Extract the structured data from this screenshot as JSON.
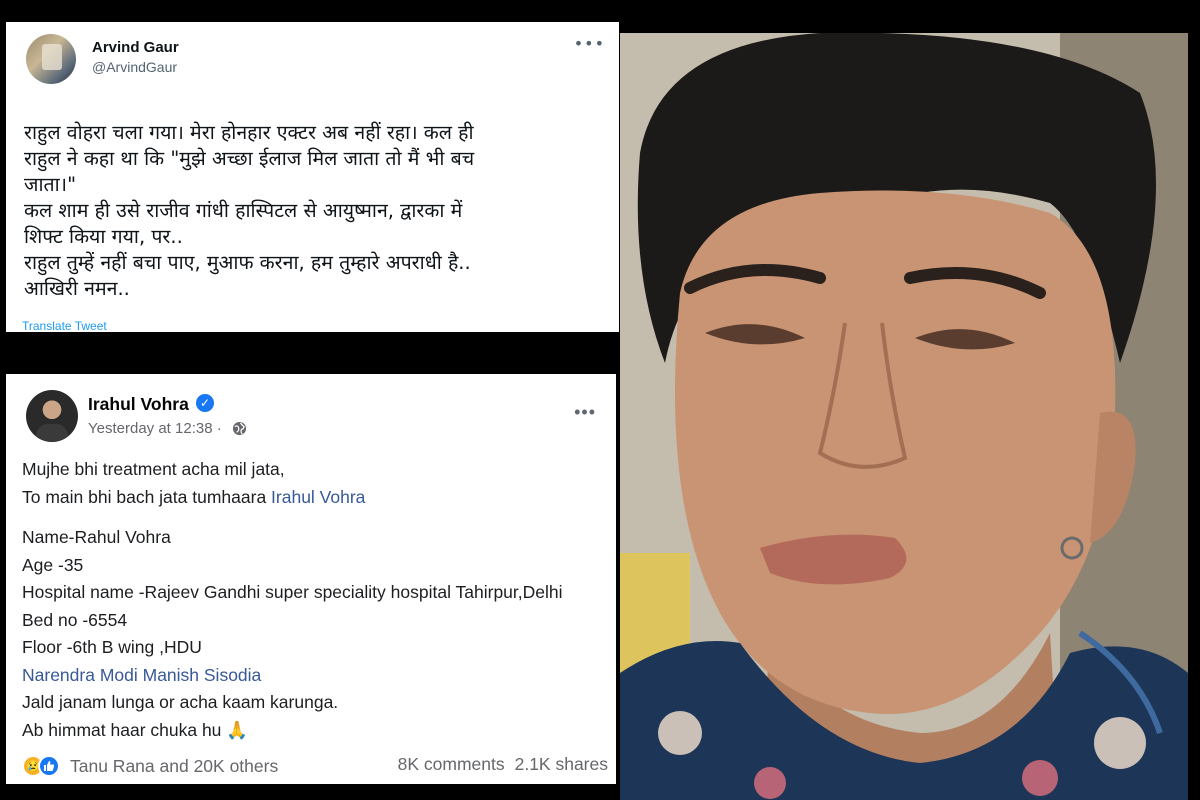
{
  "tweet": {
    "author_name": "Arvind Gaur",
    "author_handle": "@ArvindGaur",
    "more_icon": "more-horizontal-icon",
    "body_lines": [
      "राहुल वोहरा चला गया। मेरा होनहार एक्टर अब नहीं रहा। कल ही",
      "राहुल ने कहा था कि \"मुझे अच्छा ईलाज  मिल जाता तो मैं भी बच",
      "जाता।\"",
      "कल शाम ही उसे राजीव गांधी हास्पिटल से आयुष्मान, द्वारका में",
      "शिफ्ट किया गया, पर..",
      "राहुल तुम्हें नहीं बचा पाए, मुआफ करना, हम तुम्हारे अपराधी है..",
      "आखिरी नमन.."
    ],
    "translate_label": "Translate Tweet"
  },
  "facebook_post": {
    "author_name": "Irahul Vohra",
    "verified_icon": "verified-badge-icon",
    "timestamp": "Yesterday at 12:38 ·",
    "privacy_icon": "globe-icon",
    "more_icon": "more-horizontal-icon",
    "line1": "Mujhe bhi treatment acha mil jata,",
    "line2_prefix": "To main bhi bach jata tumhaara ",
    "line2_link": "Irahul Vohra",
    "name_line": "Name-Rahul Vohra",
    "age_line": "Age -35",
    "hospital_line": "Hospital name -Rajeev Gandhi super speciality hospital Tahirpur,Delhi",
    "bed_line": "Bed no -6554",
    "floor_line": "Floor -6th B wing ,HDU",
    "tags_link": "Narendra Modi Manish Sisodia",
    "line_jald": "Jald janam lunga or acha kaam karunga.",
    "line_ab": "Ab himmat haar chuka hu 🙏",
    "reactions": {
      "icons": [
        "sad-reaction-icon",
        "like-reaction-icon"
      ],
      "likers_text": "Tanu Rana and 20K others",
      "comments_text": "8K comments",
      "shares_text": "2.1K shares"
    }
  },
  "photo": {
    "subject": "portrait-photo"
  }
}
